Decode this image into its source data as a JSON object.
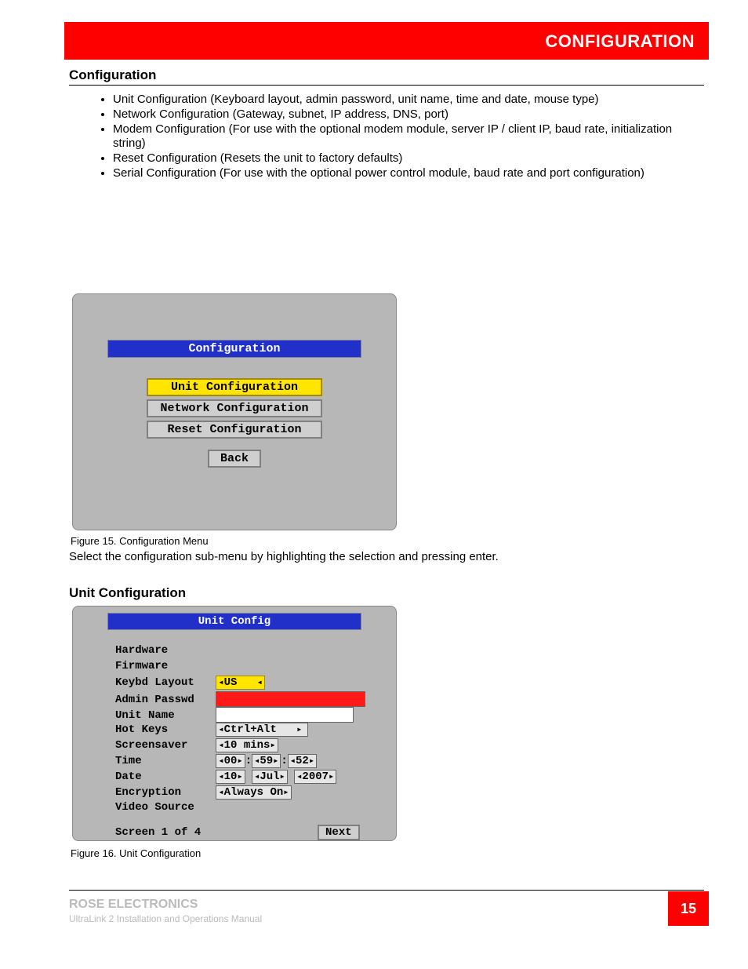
{
  "header": {
    "chapter": "CONFIGURATION"
  },
  "section_title": "Configuration",
  "bullets": [
    "Unit Configuration (Keyboard layout, admin password, unit name, time and date, mouse type)",
    "Network Configuration (Gateway, subnet, IP address, DNS, port)",
    "Modem Configuration (For use with the optional modem module, server IP / client IP, baud rate, initialization string)",
    "Reset Configuration (Resets the unit to factory defaults)",
    "Serial Configuration (For use with the optional power control module, baud rate and port configuration)"
  ],
  "fig15": {
    "caption": "Figure 15. Configuration Menu",
    "panel_title": "Configuration",
    "items": [
      "Unit Configuration",
      "Network Configuration",
      "Reset Configuration"
    ],
    "back": "Back"
  },
  "para2": "Select the configuration sub-menu by highlighting the selection and pressing enter.",
  "sub_header": "Unit Configuration",
  "fig16": {
    "caption": "Figure 16. Unit Configuration",
    "panel_title": "Unit Config",
    "fields": {
      "hardware": "Hardware",
      "firmware": "Firmware",
      "keybd": "Keybd Layout",
      "admin": "Admin Passwd",
      "unit": "Unit Name",
      "hotkeys": "Hot Keys",
      "saver": "Screensaver",
      "time": "Time",
      "date": "Date",
      "enc": "Encryption",
      "vsrc": "Video Source"
    },
    "values": {
      "keybd": "US",
      "hotkeys": "Ctrl+Alt",
      "saver": "10 mins",
      "time": [
        "00",
        "59",
        "52"
      ],
      "date": [
        "10",
        "Jul",
        "2007"
      ],
      "enc": "Always On"
    },
    "screen": "Screen 1 of 4",
    "next": "Next"
  },
  "footer": {
    "brand": "ROSE ELECTRONICS",
    "title": "UltraLink 2 Installation and Operations Manual",
    "page": "15"
  }
}
